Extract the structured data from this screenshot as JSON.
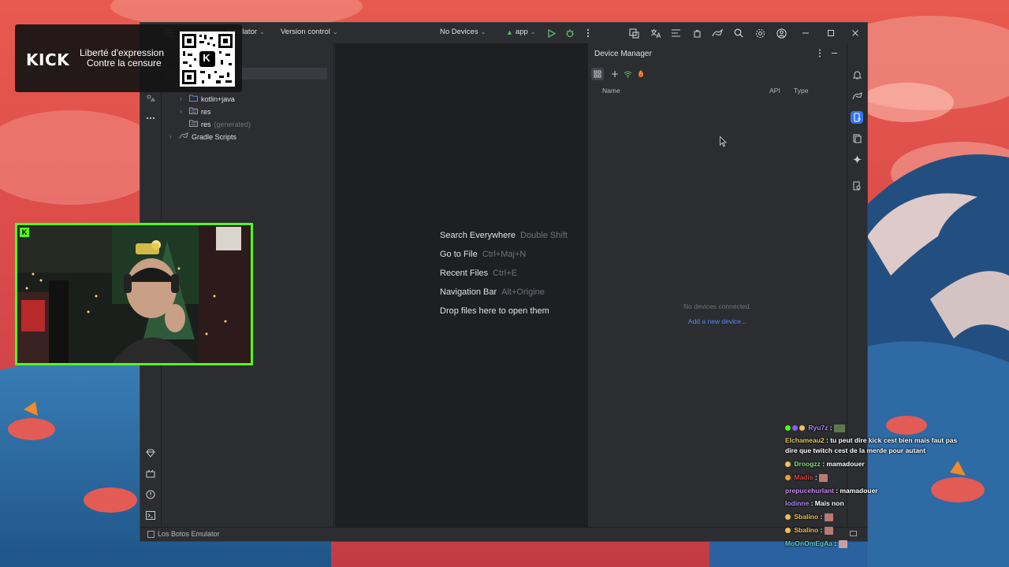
{
  "colors": {
    "ide_bg": "#2b2d30",
    "editor_bg": "#1e1f22",
    "text": "#dfe1e5",
    "muted": "#6f737a",
    "link": "#548af7",
    "run_green": "#5fb865",
    "kick_green": "#53fc18",
    "accent_blue": "#3574f0"
  },
  "titlebar": {
    "project_name": "Emulator",
    "version_control": "Version control",
    "device_selector": "No Devices",
    "run_config": "app",
    "icons": [
      "hamburger-menu-icon",
      "chevron-down-icon",
      "run-icon",
      "debug-icon",
      "more-vert-icon",
      "layout-inspector-icon",
      "translate-icon",
      "logcat-icon",
      "device-mirror-icon",
      "sync-gradle-icon",
      "search-icon",
      "settings-icon",
      "account-icon",
      "minimize-icon",
      "maximize-icon",
      "close-icon"
    ]
  },
  "project_tree": {
    "items": [
      {
        "label": "kotlin+java",
        "suffix": ""
      },
      {
        "label": "res",
        "suffix": ""
      },
      {
        "label": "res",
        "suffix": "(generated)"
      },
      {
        "label": "Gradle Scripts",
        "suffix": ""
      }
    ]
  },
  "welcome": {
    "items": [
      {
        "label": "Search Everywhere",
        "shortcut": "Double Shift"
      },
      {
        "label": "Go to File",
        "shortcut": "Ctrl+Maj+N"
      },
      {
        "label": "Recent Files",
        "shortcut": "Ctrl+E"
      },
      {
        "label": "Navigation Bar",
        "shortcut": "Alt+Origine"
      },
      {
        "label": "Drop files here to open them",
        "shortcut": ""
      }
    ]
  },
  "device_manager": {
    "title": "Device Manager",
    "columns": [
      "Name",
      "API",
      "Type"
    ],
    "empty_message": "No devices connected.",
    "add_link": "Add a new device..."
  },
  "statusbar": {
    "project": "Los Botos Emulator"
  },
  "overlay": {
    "kick_logo": "KICK",
    "tagline_1": "Liberté d'expression",
    "tagline_2": "Contre la censure",
    "qr_center": "K"
  },
  "chat": [
    {
      "user": "Ryu7z",
      "user_color": "#b085f5",
      "message": ""
    },
    {
      "user": "Elchameau2",
      "user_color": "#e8c467",
      "message": "tu peut dire kick cest bien mais faut pas dire que twitch cest de la merde pour autant"
    },
    {
      "user": "Droogzz",
      "user_color": "#7ee07e",
      "message": "mamadouer"
    },
    {
      "user": "Madis",
      "user_color": "#d64545",
      "message": ""
    },
    {
      "user": "prepucehurlant",
      "user_color": "#c58cf0",
      "message": "mamadouer"
    },
    {
      "user": "Iodinne",
      "user_color": "#b085f5",
      "message": "Mais non"
    },
    {
      "user": "Sbalino",
      "user_color": "#f0c05a",
      "message": ""
    },
    {
      "user": "Sbalino",
      "user_color": "#f0c05a",
      "message": ""
    },
    {
      "user": "MoOnOmEgAa",
      "user_color": "#5fd0c8",
      "message": ""
    }
  ]
}
